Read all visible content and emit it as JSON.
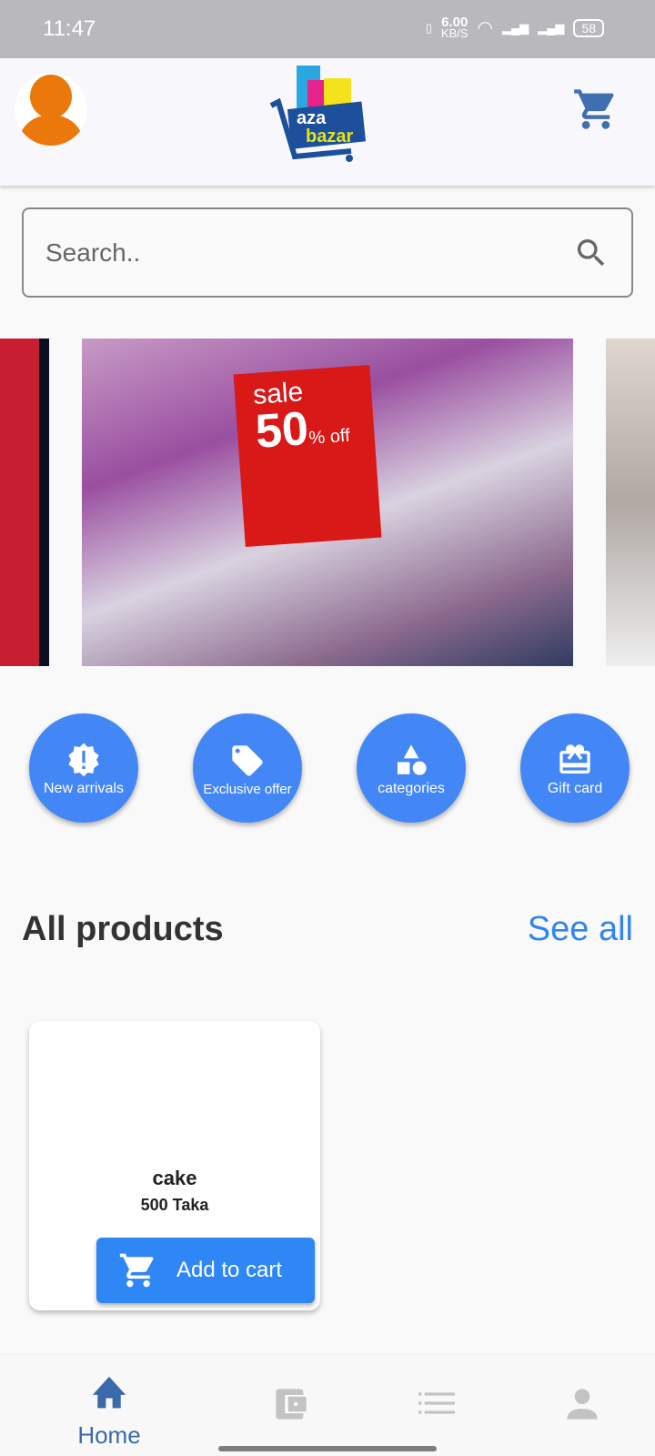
{
  "status_bar": {
    "time": "11:47",
    "net_speed": "6.00",
    "net_unit": "KB/S",
    "battery": "58"
  },
  "header": {
    "logo_text": "aza bazar",
    "logo_url": "www.azabazar.com"
  },
  "search": {
    "placeholder": "Search.."
  },
  "banner": {
    "sign_line1": "sale",
    "sign_line2": "50",
    "sign_line3": "% off"
  },
  "categories": [
    {
      "label": "New arrivals",
      "icon": "new-badge-icon"
    },
    {
      "label": "Exclusive offer",
      "icon": "tag-icon"
    },
    {
      "label": "categories",
      "icon": "shapes-icon"
    },
    {
      "label": "Gift card",
      "icon": "gift-card-icon"
    }
  ],
  "section": {
    "title": "All products",
    "see_all": "See all"
  },
  "products": [
    {
      "name": "cake",
      "price": "500 Taka",
      "button": "Add to cart"
    }
  ],
  "bottom_nav": {
    "home": "Home",
    "active": "home"
  },
  "colors": {
    "accent": "#4387f7",
    "nav_active": "#3a6aab",
    "avatar": "#eb780a"
  }
}
